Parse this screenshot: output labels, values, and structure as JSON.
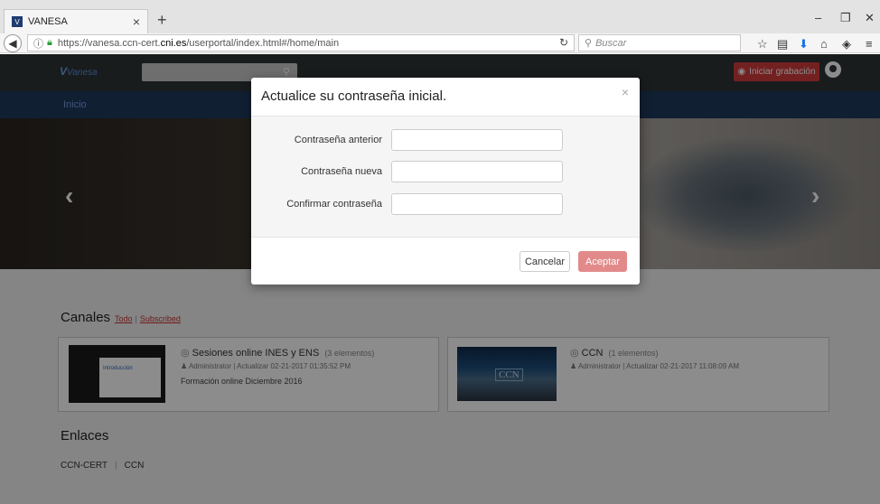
{
  "browser": {
    "tab_title": "VANESA",
    "url_prefix": "https://vanesa.ccn-cert.",
    "url_host": "cni.es",
    "url_path": "/userportal/index.html#/home/main",
    "search_placeholder": "Buscar"
  },
  "app": {
    "logo_text": "Vanesa",
    "record_label": "Iniciar grabación",
    "menu_inicio": "Inicio"
  },
  "content": {
    "canales_title": "Canales",
    "link_todo": "Todo",
    "link_subscribed": "Subscribed",
    "cards": [
      {
        "title": "Sesiones online INES y ENS",
        "count": "(3 elementos)",
        "meta": "Administrator | Actualizar 02-21-2017 01:35:52 PM",
        "desc": "Formación online Diciembre 2016",
        "thumb_label": "Introducción"
      },
      {
        "title": "CCN",
        "count": "(1 elementos)",
        "meta": "Administrator | Actualizar 02-21-2017 11:08:09 AM",
        "desc": "",
        "thumb_label": "CCN"
      }
    ],
    "enlaces_title": "Enlaces",
    "enlaces": [
      "CCN-CERT",
      "CCN"
    ]
  },
  "modal": {
    "title": "Actualice su contraseña inicial.",
    "fields": [
      {
        "label": "Contraseña anterior",
        "value": ""
      },
      {
        "label": "Contraseña nueva",
        "value": ""
      },
      {
        "label": "Confirmar contraseña",
        "value": ""
      }
    ],
    "cancel_label": "Cancelar",
    "accept_label": "Aceptar"
  },
  "colors": {
    "accent_red": "#d23b3b",
    "accept_button": "#e28a8a",
    "menu_bar": "#203a5b"
  }
}
